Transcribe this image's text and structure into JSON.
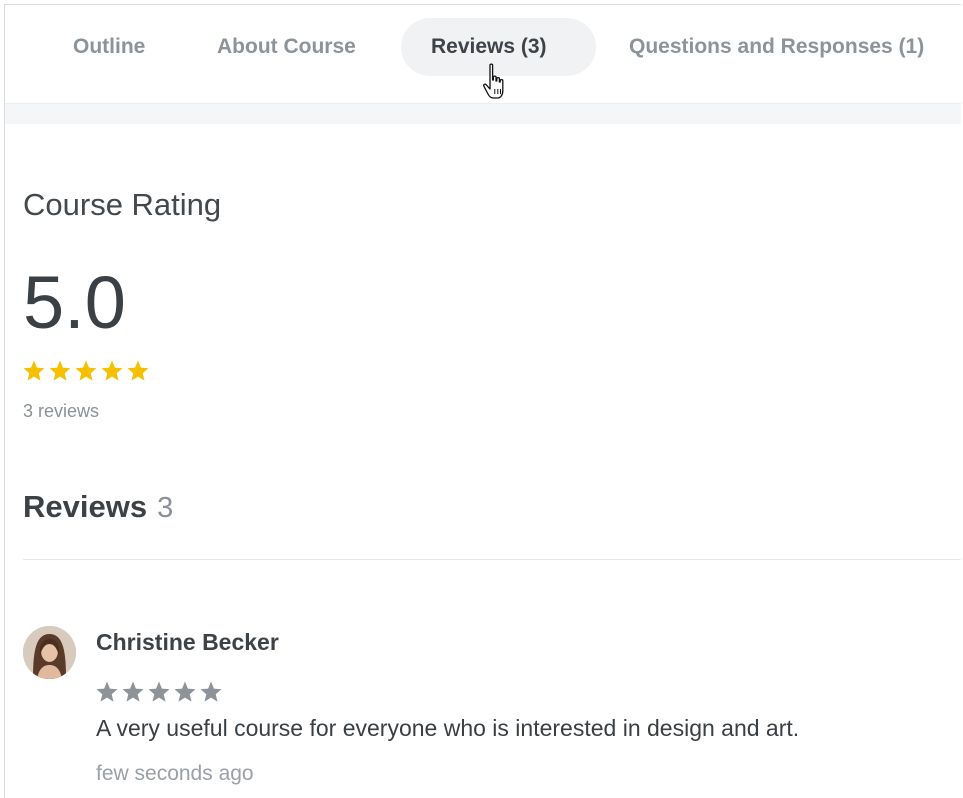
{
  "tabs": [
    {
      "label": "Outline",
      "active": false
    },
    {
      "label": "About Course",
      "active": false
    },
    {
      "label": "Reviews (3)",
      "active": true
    },
    {
      "label": "Questions and Responses (1)",
      "active": false
    }
  ],
  "cursor": {
    "icon": "hand-pointer-cursor-icon"
  },
  "course_rating": {
    "title": "Course Rating",
    "value": "5.0",
    "stars": 5,
    "star_color": "#f5c000",
    "count_text": "3 reviews"
  },
  "reviews": {
    "heading": "Reviews",
    "count": "3",
    "items": [
      {
        "avatar_icon": "user-avatar-photo",
        "name": "Christine Becker",
        "stars": 5,
        "star_color": "#8e9399",
        "text": "A very useful course for everyone who is interested in design and art.",
        "time": "few seconds ago"
      }
    ]
  }
}
